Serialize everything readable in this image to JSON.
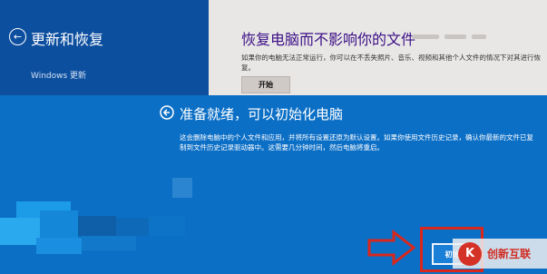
{
  "background": {
    "left_title": "更新和恢复",
    "left_nav_item": "Windows 更新",
    "right_title": "恢复电脑而不影响你的文件",
    "right_description": "如果你的电脑无法正常运行，你可以在不丢失照片、音乐、视频和其他个人文件的情况下对其进行恢复。",
    "start_button": "开始"
  },
  "dialog": {
    "title": "准备就绪，可以初始化电脑",
    "description": "这会删除电脑中的个人文件和应用，并将所有设置还原为默认设置。如果你使用文件历史记录，确认你最新的文件已复制到文件历史记录驱动器中。这需要几分钟时间，然后电脑将重启。",
    "confirm_button": "初始"
  },
  "watermark": {
    "brand": "创新互联",
    "logo_glyph": "K"
  },
  "colors": {
    "dialog_blue": "#0c6fc6",
    "settings_blue": "#0d4f9f",
    "title_purple": "#3a0e86",
    "highlight_red": "#d8271c"
  }
}
